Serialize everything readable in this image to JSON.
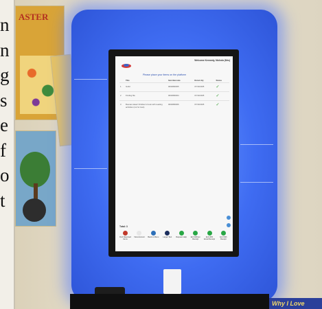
{
  "page_text_fragment": [
    "n",
    "n",
    "g",
    "s",
    "e",
    "f",
    "o",
    "t"
  ],
  "poster1": {
    "title": "ASTER"
  },
  "kiosk": {
    "header": {
      "welcome": "Welcome Kennedy, Nichola (Mrs)"
    },
    "prompt": "Please place your items on the platform",
    "table": {
      "headers": [
        "Title",
        "Item Barcode",
        "Return By",
        "Status"
      ],
      "rows": [
        {
          "num": "1",
          "title": "Guild",
          "barcode": "0004896305",
          "return_by": "07/10/2025"
        },
        {
          "num": "2",
          "title": "Finding Me",
          "barcode": "0004896304",
          "return_by": "07/10/2025"
        },
        {
          "num": "3",
          "title": "Buenas ideas! Children's book with reading activities (not for loan)",
          "barcode": "0004896306",
          "return_by": "07/10/2025"
        }
      ]
    },
    "total": "Total: 3",
    "buttons": [
      {
        "label": "Find Reserved Items",
        "color": "#c0392b"
      },
      {
        "label": "View Account",
        "color": "#e7e7e7"
      },
      {
        "label": "Back to Menu",
        "color": "#2c6fb8"
      },
      {
        "label": "Larger Text",
        "color": "#1c2f5e"
      },
      {
        "label": "Request Help",
        "color": "#28a745"
      },
      {
        "label": "Exit Without Receipt",
        "color": "#28a745"
      },
      {
        "label": "Exit With Email Receipt",
        "color": "#28a745"
      },
      {
        "label": "Exit With Receipt",
        "color": "#28a745"
      }
    ]
  },
  "sign": {
    "text": "Why I Love"
  },
  "colors": {
    "kiosk_glow": "#3f6cf2",
    "check": "#2f9a2a",
    "prompt": "#2a4fb0"
  }
}
